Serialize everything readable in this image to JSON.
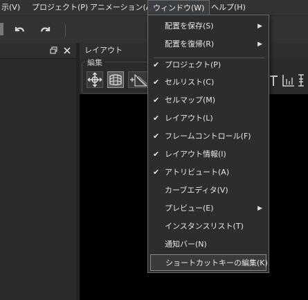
{
  "menubar": {
    "items": [
      {
        "label": "示(V)"
      },
      {
        "label": "プロジェクト(P)"
      },
      {
        "label": "アニメーション(A)"
      },
      {
        "label": "ウィンドウ(W)"
      },
      {
        "label": "ヘルプ(H)"
      }
    ]
  },
  "toolbar": {
    "undo_icon": "undo-icon",
    "redo_icon": "redo-icon"
  },
  "left_panel": {
    "float_icon": "float-window-icon",
    "close_icon": "close-icon"
  },
  "layout_panel": {
    "title": "レイアウト",
    "edit_group_label": "編集",
    "tools": [
      "move-tool-icon",
      "grid-tool-icon",
      "add-point-tool-icon"
    ]
  },
  "window_menu": {
    "items": [
      {
        "label": "配置を保存(S)",
        "checked": false,
        "submenu": true
      },
      {
        "label": "配置を復帰(R)",
        "checked": false,
        "submenu": true
      },
      {
        "label": "プロジェクト(P)",
        "checked": true,
        "submenu": false
      },
      {
        "label": "セルリスト(C)",
        "checked": true,
        "submenu": false
      },
      {
        "label": "セルマップ(M)",
        "checked": true,
        "submenu": false
      },
      {
        "label": "レイアウト(L)",
        "checked": true,
        "submenu": false
      },
      {
        "label": "フレームコントロール(F)",
        "checked": true,
        "submenu": false
      },
      {
        "label": "レイアウト情報(I)",
        "checked": true,
        "submenu": false
      },
      {
        "label": "アトリビュート(A)",
        "checked": true,
        "submenu": false
      },
      {
        "label": "カーブエディタ(V)",
        "checked": false,
        "submenu": false
      },
      {
        "label": "プレビュー(E)",
        "checked": false,
        "submenu": true
      },
      {
        "label": "インスタンスリスト(T)",
        "checked": false,
        "submenu": false
      },
      {
        "label": "通知バー(N)",
        "checked": false,
        "submenu": false
      },
      {
        "label": "ショートカットキーの編集(K)",
        "checked": false,
        "submenu": false,
        "highlighted": true
      }
    ],
    "check_glyph": "✔",
    "arrow_glyph": "▶"
  },
  "colors": {
    "menubar_bg": "#333333",
    "panel_bg": "#2b2b2b",
    "canvas_bg": "#000000",
    "menu_bg": "#2d2d2d"
  }
}
